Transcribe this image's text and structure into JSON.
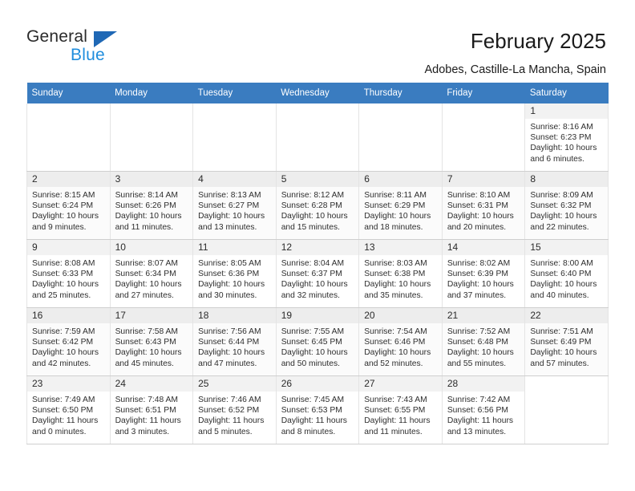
{
  "brand": {
    "name_part1": "General",
    "name_part2": "Blue",
    "triangle_color": "#1f68b5",
    "blue_color": "#1f8ddd"
  },
  "header": {
    "title": "February 2025",
    "location": "Adobes, Castille-La Mancha, Spain"
  },
  "theme": {
    "header_row_bg": "#3a7cc0",
    "header_row_text": "#ffffff",
    "daynum_bg": "#f2f2f2",
    "alt_row_bg": "#fbfbfb"
  },
  "weekdays": [
    "Sunday",
    "Monday",
    "Tuesday",
    "Wednesday",
    "Thursday",
    "Friday",
    "Saturday"
  ],
  "labels": {
    "sunrise": "Sunrise:",
    "sunset": "Sunset:",
    "daylight": "Daylight:"
  },
  "weeks": [
    [
      {
        "empty": true
      },
      {
        "empty": true
      },
      {
        "empty": true
      },
      {
        "empty": true
      },
      {
        "empty": true
      },
      {
        "empty": true
      },
      {
        "day": "1",
        "sunrise": "Sunrise: 8:16 AM",
        "sunset": "Sunset: 6:23 PM",
        "daylight": "Daylight: 10 hours and 6 minutes."
      }
    ],
    [
      {
        "day": "2",
        "sunrise": "Sunrise: 8:15 AM",
        "sunset": "Sunset: 6:24 PM",
        "daylight": "Daylight: 10 hours and 9 minutes."
      },
      {
        "day": "3",
        "sunrise": "Sunrise: 8:14 AM",
        "sunset": "Sunset: 6:26 PM",
        "daylight": "Daylight: 10 hours and 11 minutes."
      },
      {
        "day": "4",
        "sunrise": "Sunrise: 8:13 AM",
        "sunset": "Sunset: 6:27 PM",
        "daylight": "Daylight: 10 hours and 13 minutes."
      },
      {
        "day": "5",
        "sunrise": "Sunrise: 8:12 AM",
        "sunset": "Sunset: 6:28 PM",
        "daylight": "Daylight: 10 hours and 15 minutes."
      },
      {
        "day": "6",
        "sunrise": "Sunrise: 8:11 AM",
        "sunset": "Sunset: 6:29 PM",
        "daylight": "Daylight: 10 hours and 18 minutes."
      },
      {
        "day": "7",
        "sunrise": "Sunrise: 8:10 AM",
        "sunset": "Sunset: 6:31 PM",
        "daylight": "Daylight: 10 hours and 20 minutes."
      },
      {
        "day": "8",
        "sunrise": "Sunrise: 8:09 AM",
        "sunset": "Sunset: 6:32 PM",
        "daylight": "Daylight: 10 hours and 22 minutes."
      }
    ],
    [
      {
        "day": "9",
        "sunrise": "Sunrise: 8:08 AM",
        "sunset": "Sunset: 6:33 PM",
        "daylight": "Daylight: 10 hours and 25 minutes."
      },
      {
        "day": "10",
        "sunrise": "Sunrise: 8:07 AM",
        "sunset": "Sunset: 6:34 PM",
        "daylight": "Daylight: 10 hours and 27 minutes."
      },
      {
        "day": "11",
        "sunrise": "Sunrise: 8:05 AM",
        "sunset": "Sunset: 6:36 PM",
        "daylight": "Daylight: 10 hours and 30 minutes."
      },
      {
        "day": "12",
        "sunrise": "Sunrise: 8:04 AM",
        "sunset": "Sunset: 6:37 PM",
        "daylight": "Daylight: 10 hours and 32 minutes."
      },
      {
        "day": "13",
        "sunrise": "Sunrise: 8:03 AM",
        "sunset": "Sunset: 6:38 PM",
        "daylight": "Daylight: 10 hours and 35 minutes."
      },
      {
        "day": "14",
        "sunrise": "Sunrise: 8:02 AM",
        "sunset": "Sunset: 6:39 PM",
        "daylight": "Daylight: 10 hours and 37 minutes."
      },
      {
        "day": "15",
        "sunrise": "Sunrise: 8:00 AM",
        "sunset": "Sunset: 6:40 PM",
        "daylight": "Daylight: 10 hours and 40 minutes."
      }
    ],
    [
      {
        "day": "16",
        "sunrise": "Sunrise: 7:59 AM",
        "sunset": "Sunset: 6:42 PM",
        "daylight": "Daylight: 10 hours and 42 minutes."
      },
      {
        "day": "17",
        "sunrise": "Sunrise: 7:58 AM",
        "sunset": "Sunset: 6:43 PM",
        "daylight": "Daylight: 10 hours and 45 minutes."
      },
      {
        "day": "18",
        "sunrise": "Sunrise: 7:56 AM",
        "sunset": "Sunset: 6:44 PM",
        "daylight": "Daylight: 10 hours and 47 minutes."
      },
      {
        "day": "19",
        "sunrise": "Sunrise: 7:55 AM",
        "sunset": "Sunset: 6:45 PM",
        "daylight": "Daylight: 10 hours and 50 minutes."
      },
      {
        "day": "20",
        "sunrise": "Sunrise: 7:54 AM",
        "sunset": "Sunset: 6:46 PM",
        "daylight": "Daylight: 10 hours and 52 minutes."
      },
      {
        "day": "21",
        "sunrise": "Sunrise: 7:52 AM",
        "sunset": "Sunset: 6:48 PM",
        "daylight": "Daylight: 10 hours and 55 minutes."
      },
      {
        "day": "22",
        "sunrise": "Sunrise: 7:51 AM",
        "sunset": "Sunset: 6:49 PM",
        "daylight": "Daylight: 10 hours and 57 minutes."
      }
    ],
    [
      {
        "day": "23",
        "sunrise": "Sunrise: 7:49 AM",
        "sunset": "Sunset: 6:50 PM",
        "daylight": "Daylight: 11 hours and 0 minutes."
      },
      {
        "day": "24",
        "sunrise": "Sunrise: 7:48 AM",
        "sunset": "Sunset: 6:51 PM",
        "daylight": "Daylight: 11 hours and 3 minutes."
      },
      {
        "day": "25",
        "sunrise": "Sunrise: 7:46 AM",
        "sunset": "Sunset: 6:52 PM",
        "daylight": "Daylight: 11 hours and 5 minutes."
      },
      {
        "day": "26",
        "sunrise": "Sunrise: 7:45 AM",
        "sunset": "Sunset: 6:53 PM",
        "daylight": "Daylight: 11 hours and 8 minutes."
      },
      {
        "day": "27",
        "sunrise": "Sunrise: 7:43 AM",
        "sunset": "Sunset: 6:55 PM",
        "daylight": "Daylight: 11 hours and 11 minutes."
      },
      {
        "day": "28",
        "sunrise": "Sunrise: 7:42 AM",
        "sunset": "Sunset: 6:56 PM",
        "daylight": "Daylight: 11 hours and 13 minutes."
      },
      {
        "empty": true
      }
    ]
  ]
}
